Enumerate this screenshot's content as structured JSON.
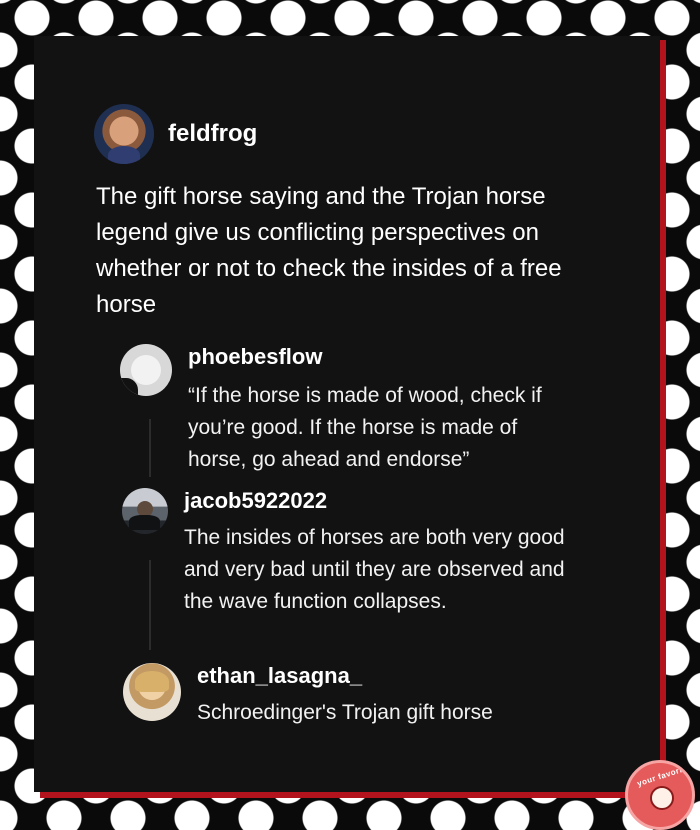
{
  "post": {
    "author": "feldfrog",
    "text": "The gift horse saying and the Trojan horse legend give us conflicting perspectives on whether or not to check the insides of a free horse"
  },
  "replies": [
    {
      "author": "phoebesflow",
      "text": "“If the horse is made of wood, check if you’re good. If the horse is made of horse, go ahead and endorse”"
    },
    {
      "author": "jacob5922022",
      "text": "The insides of horses are both very good and very bad until they are observed and the wave function collapses."
    },
    {
      "author": "ethan_lasagna_",
      "text": "Schroedinger's Trojan gift horse"
    }
  ],
  "badge": {
    "label": "your favorite",
    "icon": "cartoon-face-icon",
    "color": "#e55b5b"
  },
  "colors": {
    "background": "#0a0a0a",
    "dots": "#ffffff",
    "card": "#121212",
    "accent_edge": "#b3131d"
  }
}
